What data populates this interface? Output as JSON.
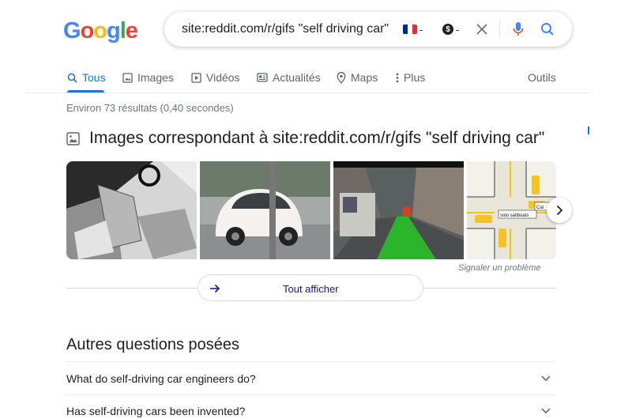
{
  "logo": {
    "letters": [
      "G",
      "o",
      "o",
      "g",
      "l",
      "e"
    ],
    "colors": [
      "#4285f4",
      "#ea4335",
      "#fbbc05",
      "#4285f4",
      "#34a853",
      "#ea4335"
    ]
  },
  "search": {
    "query": "site:reddit.com/r/gifs \"self driving car\"",
    "chip_separator": "-"
  },
  "tabs": [
    {
      "label": "Tous",
      "icon": "search-icon",
      "active": true
    },
    {
      "label": "Images",
      "icon": "image-icon"
    },
    {
      "label": "Vidéos",
      "icon": "video-icon"
    },
    {
      "label": "Actualités",
      "icon": "news-icon"
    },
    {
      "label": "Maps",
      "icon": "map-pin-icon"
    },
    {
      "label": "Plus",
      "icon": "more-vert-icon"
    }
  ],
  "tools_label": "Outils",
  "stats": "Environ 73 résultats (0,40 secondes)",
  "images_section": {
    "heading": "Images correspondant à site:reddit.com/r/gifs \"self driving car\"",
    "report_label": "Signaler un problème",
    "show_all_label": "Tout afficher",
    "thumbnail_texts": [
      "Car",
      "solo sailboats"
    ]
  },
  "people_also_ask": {
    "title": "Autres questions posées",
    "questions": [
      "What do self-driving car engineers do?",
      "Has self-driving cars been invented?"
    ]
  },
  "colors": {
    "accent": "#1a73e8",
    "mic_blue": "#4285f4",
    "mic_red": "#ea4335",
    "text_gray": "#5f6368"
  }
}
